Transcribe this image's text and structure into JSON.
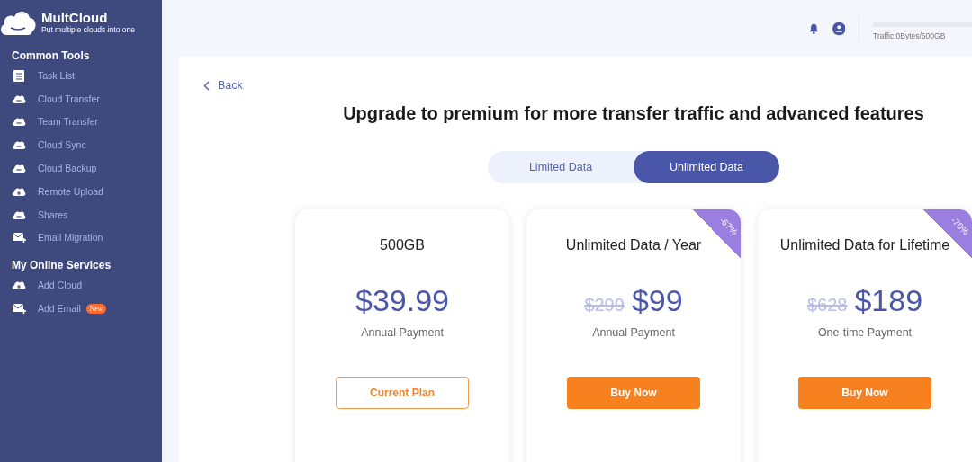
{
  "brand": {
    "name": "MultCloud",
    "tagline": "Put multiple clouds into one"
  },
  "sidebar": {
    "sections": [
      {
        "title": "Common Tools",
        "items": [
          {
            "label": "Task List"
          },
          {
            "label": "Cloud Transfer"
          },
          {
            "label": "Team Transfer"
          },
          {
            "label": "Cloud Sync"
          },
          {
            "label": "Cloud Backup"
          },
          {
            "label": "Remote Upload"
          },
          {
            "label": "Shares"
          },
          {
            "label": "Email Migration"
          }
        ]
      },
      {
        "title": "My Online Services",
        "items": [
          {
            "label": "Add Cloud"
          },
          {
            "label": "Add Email",
            "badge": "New"
          }
        ]
      }
    ]
  },
  "topbar": {
    "traffic": "Traffic:0Bytes/500GB",
    "traffic_level": {
      "level": 0
    }
  },
  "back": "Back",
  "heading": "Upgrade to premium for more transfer traffic and advanced features",
  "tabs": [
    {
      "label": "Limited Data",
      "selected": false
    },
    {
      "label": "Unlimited Data",
      "selected": true
    }
  ],
  "plans": [
    {
      "title": "500GB",
      "price": "$39.99",
      "period": "Annual Payment",
      "button": {
        "label": "Current Plan",
        "kind": "current"
      }
    },
    {
      "title": "Unlimited Data / Year",
      "old_price": "$299",
      "price": "$99",
      "period": "Annual Payment",
      "discount": "-67%",
      "button": {
        "label": "Buy Now",
        "kind": "buy"
      }
    },
    {
      "title": "Unlimited Data for Lifetime",
      "old_price": "$628",
      "price": "$189",
      "period": "One-time Payment",
      "discount": "-70%",
      "button": {
        "label": "Buy Now",
        "kind": "buy"
      }
    }
  ]
}
